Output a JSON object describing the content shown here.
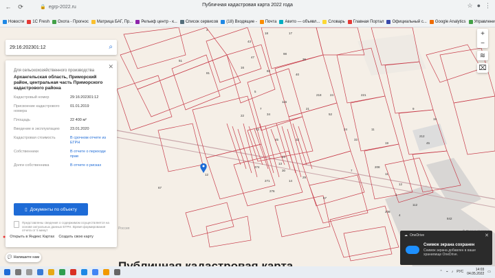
{
  "browser": {
    "address": "egrp-2022.ru",
    "page_title": "Публичная кадастровая карта 2022 года",
    "bookmarks": [
      "Новости",
      "1С Fresh",
      "Охота - Прогнос",
      "Матрица БАГ, Пр...",
      "Рельеф центр - к...",
      "Список сервисов",
      "(18) Входящие -",
      "Почта",
      "Авито — объявл...",
      "Словарь",
      "Главная Портал",
      "Официальный с...",
      "Google Analytics",
      "Управление сайт...",
      "Другие"
    ],
    "bookmark_colors": [
      "#1e88e5",
      "#e53935",
      "#43a047",
      "#fbc02d",
      "#8e24aa",
      "#546e7a",
      "#1e88e5",
      "#fb8c00",
      "#00acc1",
      "#fdd835",
      "#e53935",
      "#3949ab",
      "#ef6c00",
      "#43a047",
      "#757575"
    ]
  },
  "search": {
    "value": "29:16:202301:12",
    "icon": "search-icon"
  },
  "card": {
    "purpose": "Для сельскохозяйственного производства",
    "address": "Архангельская область, Приморский район, центральная часть Приморского кадастрового района",
    "rows": [
      {
        "k": "Кадастровый номер",
        "v": "29:16:202301:12",
        "link": false
      },
      {
        "k": "Присвоение кадастрового номера",
        "v": "01.01.2019",
        "link": false
      },
      {
        "k": "Площадь",
        "v": "22 400 м²",
        "link": false
      },
      {
        "k": "Введение в эксплуатацию",
        "v": "23.01.2020",
        "link": false
      },
      {
        "k": "Кадастровая стоимость",
        "v": "В срочном отчете из ЕГРН",
        "link": true
      },
      {
        "k": "Собственники",
        "v": "В отчете о переходе прав",
        "link": true
      },
      {
        "k": "Долги собственника",
        "v": "В отчете о рисках",
        "link": true
      }
    ],
    "button": "Документы по объекту",
    "note": "Представлены сведения о содержимом осуществляется на основе актуальных данных ЕГРН. Время формирования отчета от 5 минут"
  },
  "map": {
    "parcels": [
      "2",
      "43",
      "47",
      "18",
      "17",
      "16",
      "82",
      "98",
      "36",
      "40",
      "51",
      "81",
      "5",
      "218",
      "21",
      "52",
      "24",
      "33",
      "11",
      "19",
      "22",
      "34",
      "42",
      "45",
      "32",
      "23",
      "30",
      "29",
      "57",
      "115",
      "221",
      "208",
      "11",
      "12",
      "13",
      "14",
      "7",
      "9",
      "45",
      "15",
      "24",
      "7",
      "67",
      "274",
      "271",
      "276",
      "1",
      "112",
      "208",
      "4",
      "842",
      "212"
    ],
    "pin_label": "12",
    "yandex_open": "Открыть в Яндекс Картах",
    "yandex_create": "Создать свою карту",
    "copyright": "© Яндекс Условия"
  },
  "controls": {
    "zoom_in": "+",
    "zoom_out": "−"
  },
  "page": {
    "region": "Россия",
    "title": "Публичная кадастровая карта",
    "chat": "Напишите нам"
  },
  "toast": {
    "app": "OneDrive",
    "title": "Снимок экрана сохранен",
    "text": "Снимок экрана добавлен в ваше хранилище OneDrive."
  },
  "taskbar": {
    "lang": "РУС",
    "time": "14:03",
    "date": "04.05.2022"
  }
}
